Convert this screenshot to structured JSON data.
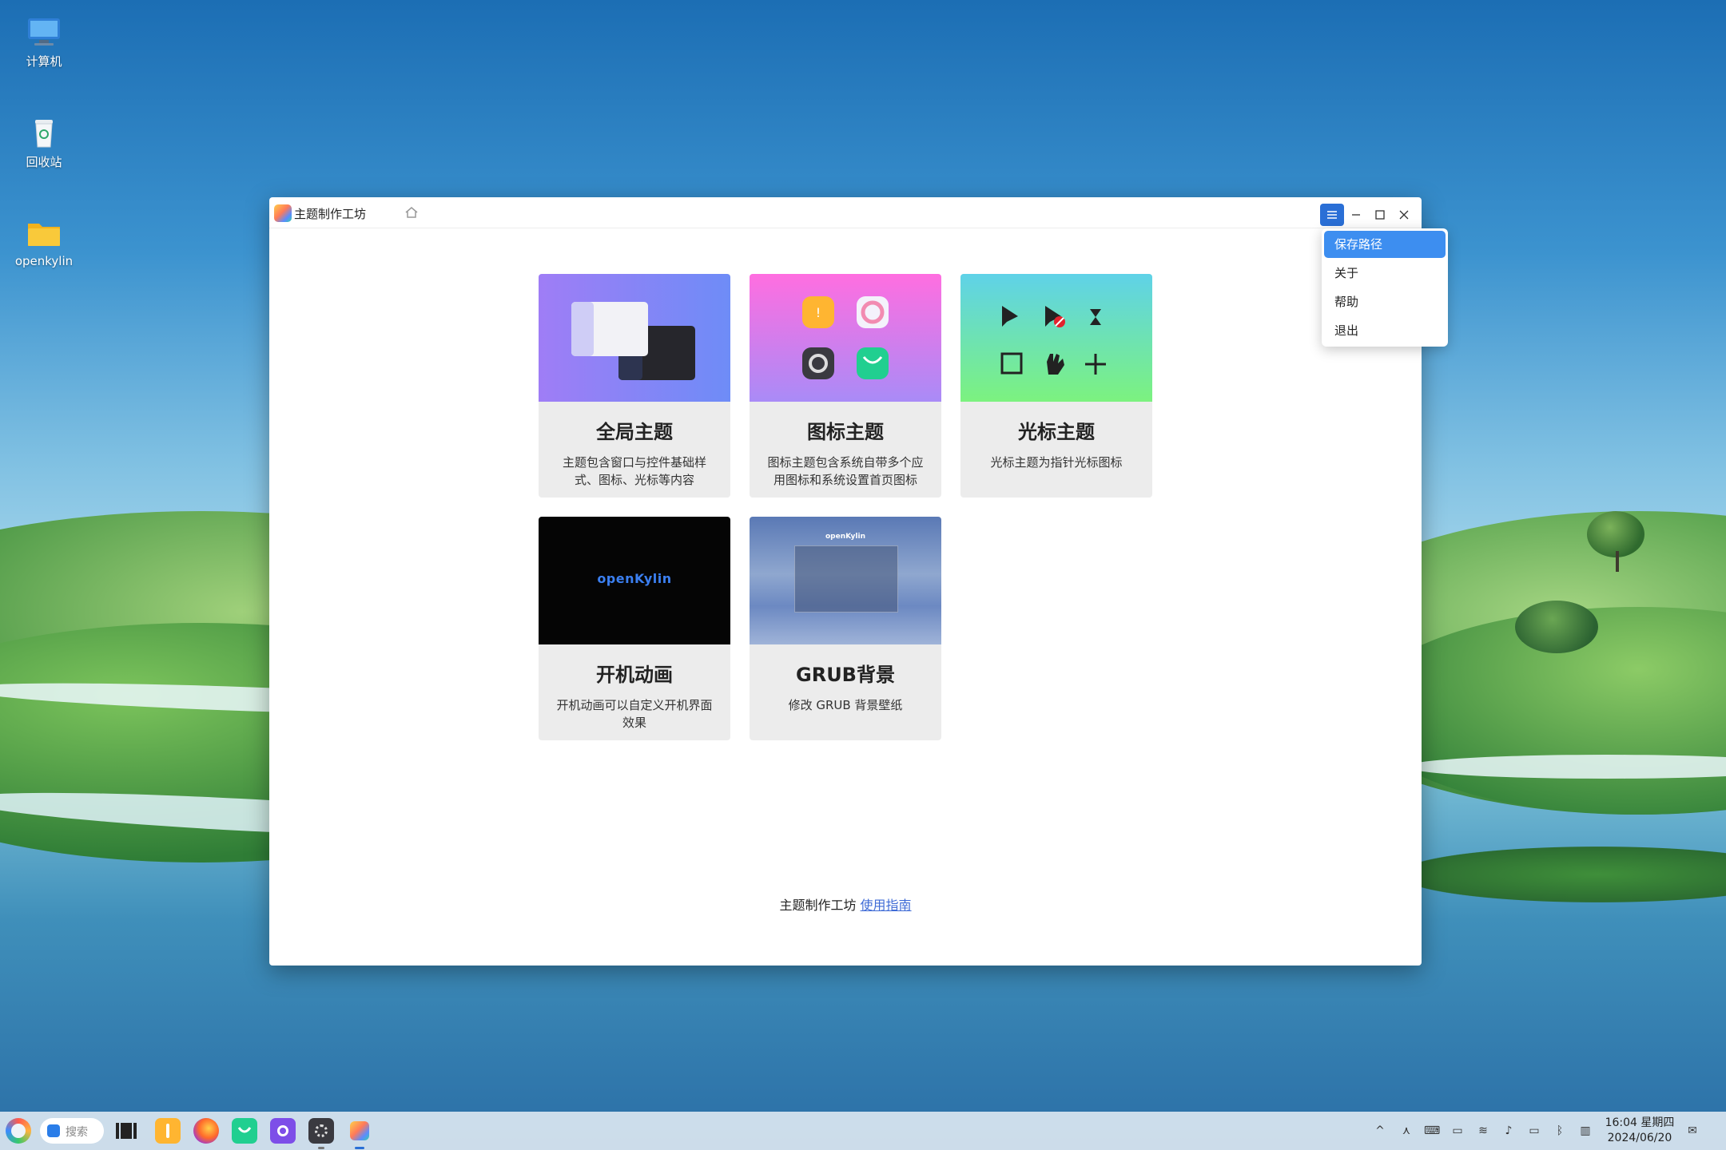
{
  "desktop": {
    "icons": [
      {
        "label": "计算机",
        "icon": "computer-icon"
      },
      {
        "label": "回收站",
        "icon": "trash-icon"
      },
      {
        "label": "openkylin",
        "icon": "folder-icon"
      }
    ]
  },
  "window": {
    "title": "主题制作工坊",
    "menu": {
      "items": [
        {
          "label": "保存路径",
          "active": true
        },
        {
          "label": "关于"
        },
        {
          "label": "帮助"
        },
        {
          "label": "退出"
        }
      ]
    },
    "cards": [
      {
        "title": "全局主题",
        "desc": "主题包含窗口与控件基础样式、图标、光标等内容"
      },
      {
        "title": "图标主题",
        "desc": "图标主题包含系统自带多个应用图标和系统设置首页图标"
      },
      {
        "title": "光标主题",
        "desc": "光标主题为指针光标图标"
      },
      {
        "title": "开机动画",
        "desc": "开机动画可以自定义开机界面效果",
        "logo": "openKylin"
      },
      {
        "title": "GRUB背景",
        "desc": "修改 GRUB 背景壁纸",
        "logo": "openKylin"
      }
    ],
    "footer": {
      "text": "主题制作工坊",
      "link": "使用指南"
    }
  },
  "taskbar": {
    "search_placeholder": "搜索",
    "time": "16:04 星期四",
    "date": "2024/06/20"
  },
  "colors": {
    "accent": "#2a6fd6",
    "menu_highlight": "#3d8ef0",
    "link": "#3f6bd6"
  }
}
